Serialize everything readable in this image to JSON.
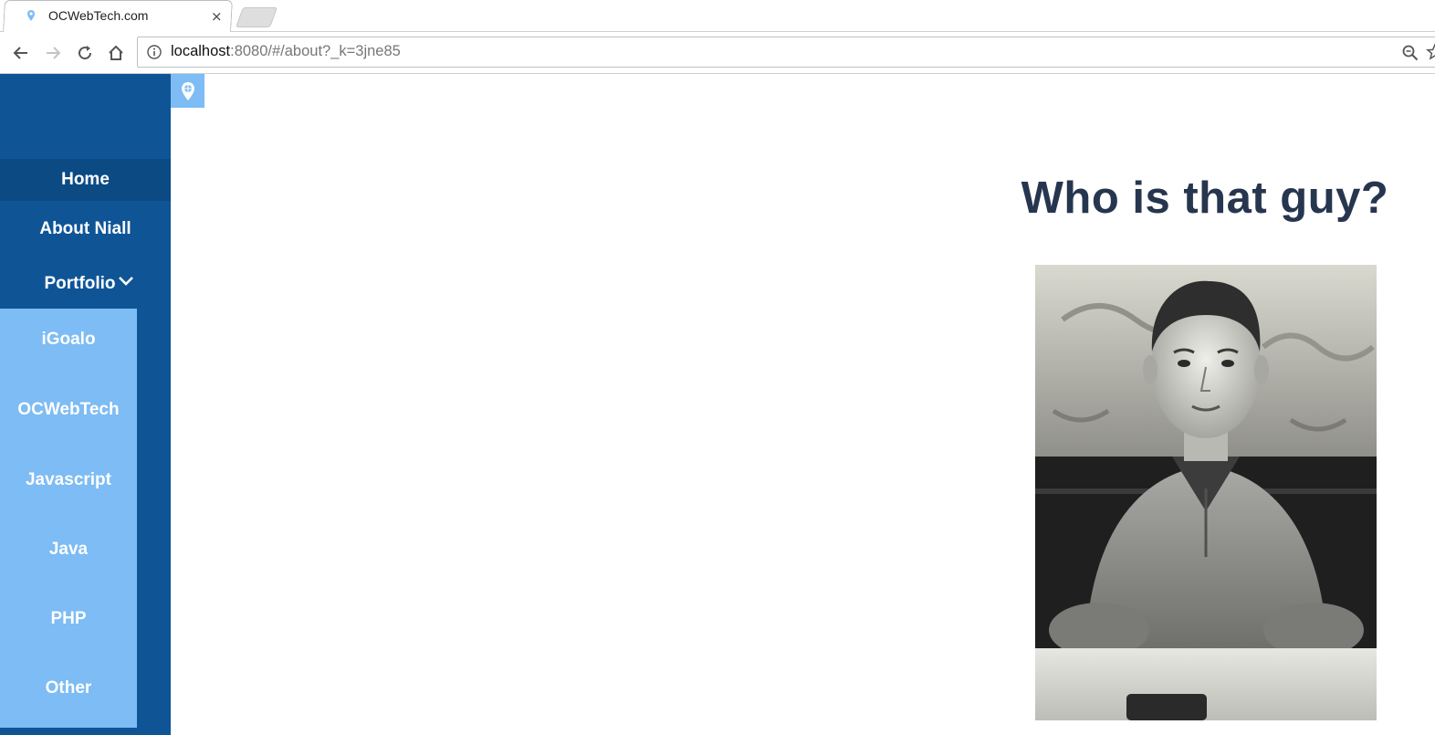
{
  "browser": {
    "tab": {
      "title": "OCWebTech.com",
      "close": "×"
    },
    "address": {
      "host": "localhost",
      "rest": ":8080/#/about?_k=3jne85"
    }
  },
  "sidebar": {
    "home": "Home",
    "about": "About Niall",
    "portfolio": "Portfolio",
    "submenu": [
      "iGoalo",
      "OCWebTech",
      "Javascript",
      "Java",
      "PHP",
      "Other"
    ]
  },
  "main": {
    "heading": "Who is that guy?"
  },
  "colors": {
    "sidebar": "#0f5596",
    "sidebar_active": "#0b4a83",
    "submenu": "#7dbcf4",
    "heading": "#27364f"
  }
}
